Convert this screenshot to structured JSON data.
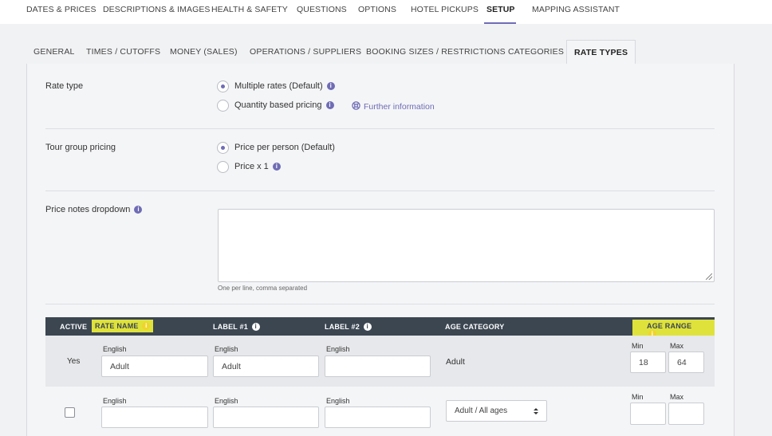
{
  "topnav": {
    "items": [
      "DATES & PRICES",
      "DESCRIPTIONS & IMAGES",
      "HEALTH & SAFETY",
      "QUESTIONS",
      "OPTIONS",
      "HOTEL PICKUPS",
      "SETUP",
      "MAPPING ASSISTANT"
    ],
    "active": "SETUP"
  },
  "subtabs": {
    "items": [
      "GENERAL",
      "TIMES / CUTOFFS",
      "MONEY (SALES)",
      "OPERATIONS / SUPPLIERS",
      "BOOKING SIZES / RESTRICTIONS",
      "CATEGORIES",
      "RATE TYPES"
    ],
    "active": "RATE TYPES"
  },
  "rate_type": {
    "label": "Rate type",
    "options": [
      "Multiple rates (Default)",
      "Quantity based pricing"
    ],
    "selected": "Multiple rates (Default)",
    "further_info": "Further information"
  },
  "tour_group": {
    "label": "Tour group pricing",
    "options": [
      "Price per person (Default)",
      "Price x 1"
    ],
    "selected": "Price per person (Default)"
  },
  "price_notes": {
    "label": "Price notes dropdown",
    "value": "",
    "hint": "One per line, comma separated"
  },
  "table": {
    "headers": [
      "ACTIVE",
      "RATE NAME",
      "LABEL #1",
      "LABEL #2",
      "AGE CATEGORY",
      "AGE RANGE"
    ],
    "highlight_color": "#dfe23b",
    "header_bg": "#3b4651",
    "lang_label": "English",
    "min_label": "Min",
    "max_label": "Max",
    "rows": [
      {
        "active": "Yes",
        "rate_name": "Adult",
        "label1": "Adult",
        "label2": "",
        "age_category": "Adult",
        "min": "18",
        "max": "64"
      },
      {
        "active": "",
        "rate_name": "",
        "label1": "",
        "label2": "",
        "age_category": "Adult / All ages",
        "min": "",
        "max": ""
      }
    ]
  },
  "icons": [
    "info-icon",
    "lifebuoy-icon",
    "checkbox-icon",
    "select-arrows-icon",
    "resize-grip-icon"
  ],
  "accent_color": "#6f6cb5"
}
